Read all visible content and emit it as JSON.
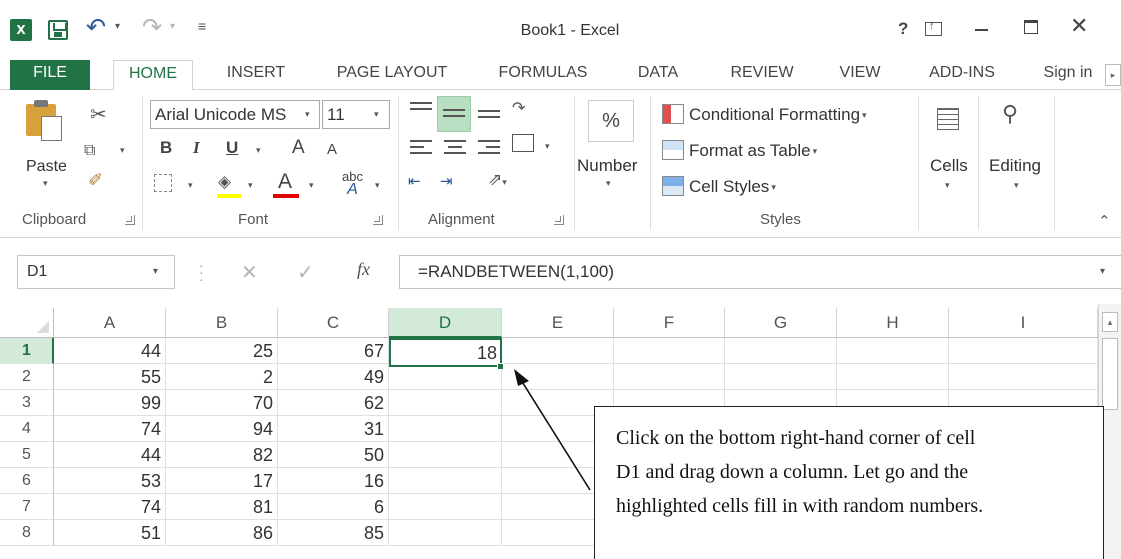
{
  "window": {
    "title": "Book1 - Excel",
    "help": "?"
  },
  "tabs": [
    {
      "label": "FILE"
    },
    {
      "label": "HOME"
    },
    {
      "label": "INSERT"
    },
    {
      "label": "PAGE LAYOUT"
    },
    {
      "label": "FORMULAS"
    },
    {
      "label": "DATA"
    },
    {
      "label": "REVIEW"
    },
    {
      "label": "VIEW"
    },
    {
      "label": "ADD-INS"
    }
  ],
  "sign_in": "Sign in",
  "ribbon": {
    "clipboard": {
      "label": "Clipboard",
      "paste": "Paste"
    },
    "font": {
      "label": "Font",
      "font_name": "Arial Unicode MS",
      "font_size": "11",
      "bold": "B",
      "italic": "I",
      "underline": "U",
      "grow": "A",
      "shrink": "A",
      "font_color": "A",
      "phonetic_top": "abc",
      "phonetic_bottom": "A"
    },
    "alignment": {
      "label": "Alignment"
    },
    "number": {
      "label": "Number",
      "format_button": "%"
    },
    "styles": {
      "label": "Styles",
      "conditional_formatting": "Conditional Formatting",
      "format_as_table": "Format as Table",
      "cell_styles": "Cell Styles"
    },
    "cells": {
      "label": "Cells"
    },
    "editing": {
      "label": "Editing"
    }
  },
  "formula_bar": {
    "name_box": "D1",
    "fx": "fx",
    "formula": "=RANDBETWEEN(1,100)"
  },
  "sheet": {
    "columns": [
      "A",
      "B",
      "C",
      "D",
      "E",
      "F",
      "G",
      "H",
      "I"
    ],
    "rows": [
      "1",
      "2",
      "3",
      "4",
      "5",
      "6",
      "7",
      "8"
    ],
    "selected_column": "D",
    "selected_row": "1",
    "active_cell_value": "18",
    "data": [
      [
        "44",
        "25",
        "67"
      ],
      [
        "55",
        "2",
        "49"
      ],
      [
        "99",
        "70",
        "62"
      ],
      [
        "74",
        "94",
        "31"
      ],
      [
        "44",
        "82",
        "50"
      ],
      [
        "53",
        "17",
        "16"
      ],
      [
        "74",
        "81",
        "6"
      ],
      [
        "51",
        "86",
        "85"
      ]
    ]
  },
  "callout": {
    "lines": [
      "Click on the bottom right-hand corner of cell",
      "D1 and drag down a column. Let go and the",
      "highlighted cells fill in with random numbers."
    ]
  },
  "colors": {
    "accent": "#217346",
    "selected_header_bg": "#d3e9da",
    "fill_yellow": "#ffff00",
    "font_red": "#e00000"
  },
  "icons": [
    "excel-logo-icon",
    "save-icon",
    "undo-icon",
    "redo-icon",
    "customize-qat-icon",
    "help-icon",
    "ribbon-display-options-icon",
    "minimize-icon",
    "maximize-icon",
    "close-icon",
    "paste-icon",
    "cut-icon",
    "copy-icon",
    "format-painter-icon",
    "borders-icon",
    "fill-color-icon",
    "font-color-icon",
    "wrap-text-icon",
    "merge-center-icon",
    "orientation-icon",
    "conditional-formatting-icon",
    "format-as-table-icon",
    "cell-styles-icon",
    "cells-icon",
    "find-select-icon"
  ]
}
